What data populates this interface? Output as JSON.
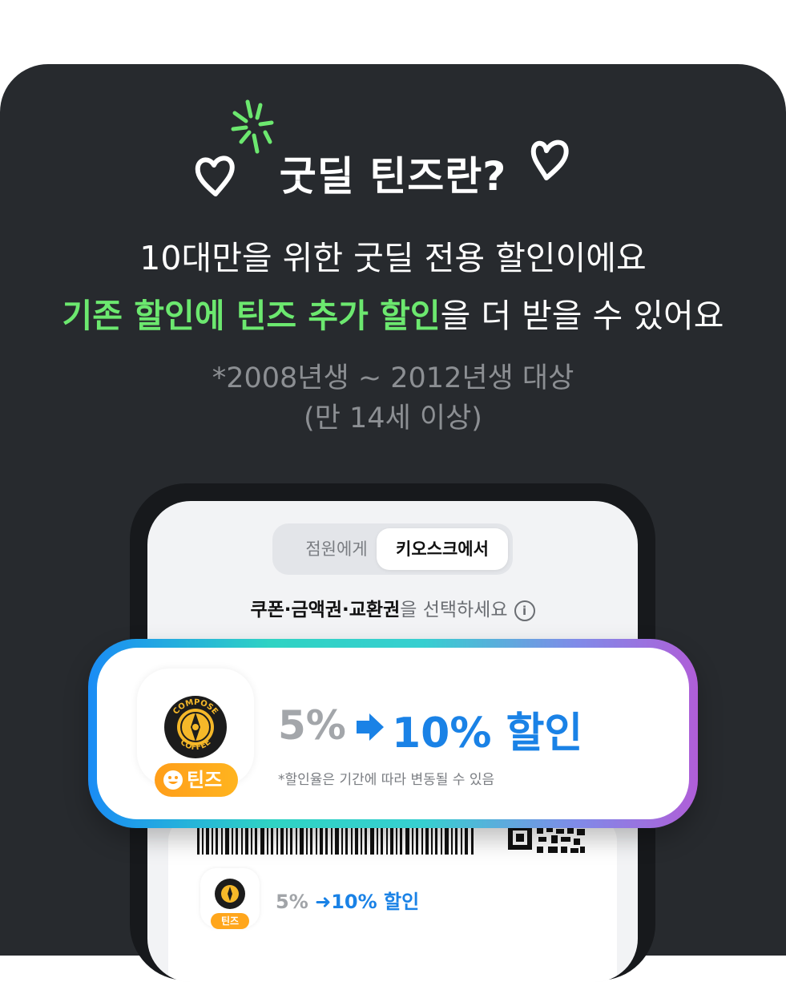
{
  "header": {
    "title": "굿딜 틴즈란?",
    "line1": "10대만을 위한 굿딜 전용 할인이에요",
    "line2_highlight": "기존 할인에 틴즈 추가 할인",
    "line2_rest": "을 더 받을 수 있어요",
    "note1": "*2008년생 ~ 2012년생 대상",
    "note2": "(만 14세 이상)"
  },
  "phone": {
    "tabs": [
      "점원에게",
      "키오스크에서"
    ],
    "selected_tab": "키오스크에서",
    "select_bold": "쿠폰·금액권·교환권",
    "select_rest": "을 선택하세요",
    "info_icon": "i",
    "mini": {
      "old": "5%",
      "new": "10% 할인",
      "badge": "틴즈"
    }
  },
  "banner": {
    "brand_top": "COMPOSE",
    "brand_bottom": "COFFEE",
    "badge": "틴즈",
    "old": "5%",
    "new": "10% 할인",
    "fine_print": "*할인율은 기간에 따라 변동될 수 있음"
  },
  "colors": {
    "background": "#272a2e",
    "highlight": "#6ce86f",
    "accent_blue": "#1a82e6",
    "badge_orange": "#ffa61c",
    "brand_yellow": "#f5b829"
  },
  "icons": [
    "heart-icon",
    "sparkle-icon",
    "info-icon",
    "arrow-right-icon",
    "smile-icon",
    "barcode",
    "qr-code"
  ]
}
